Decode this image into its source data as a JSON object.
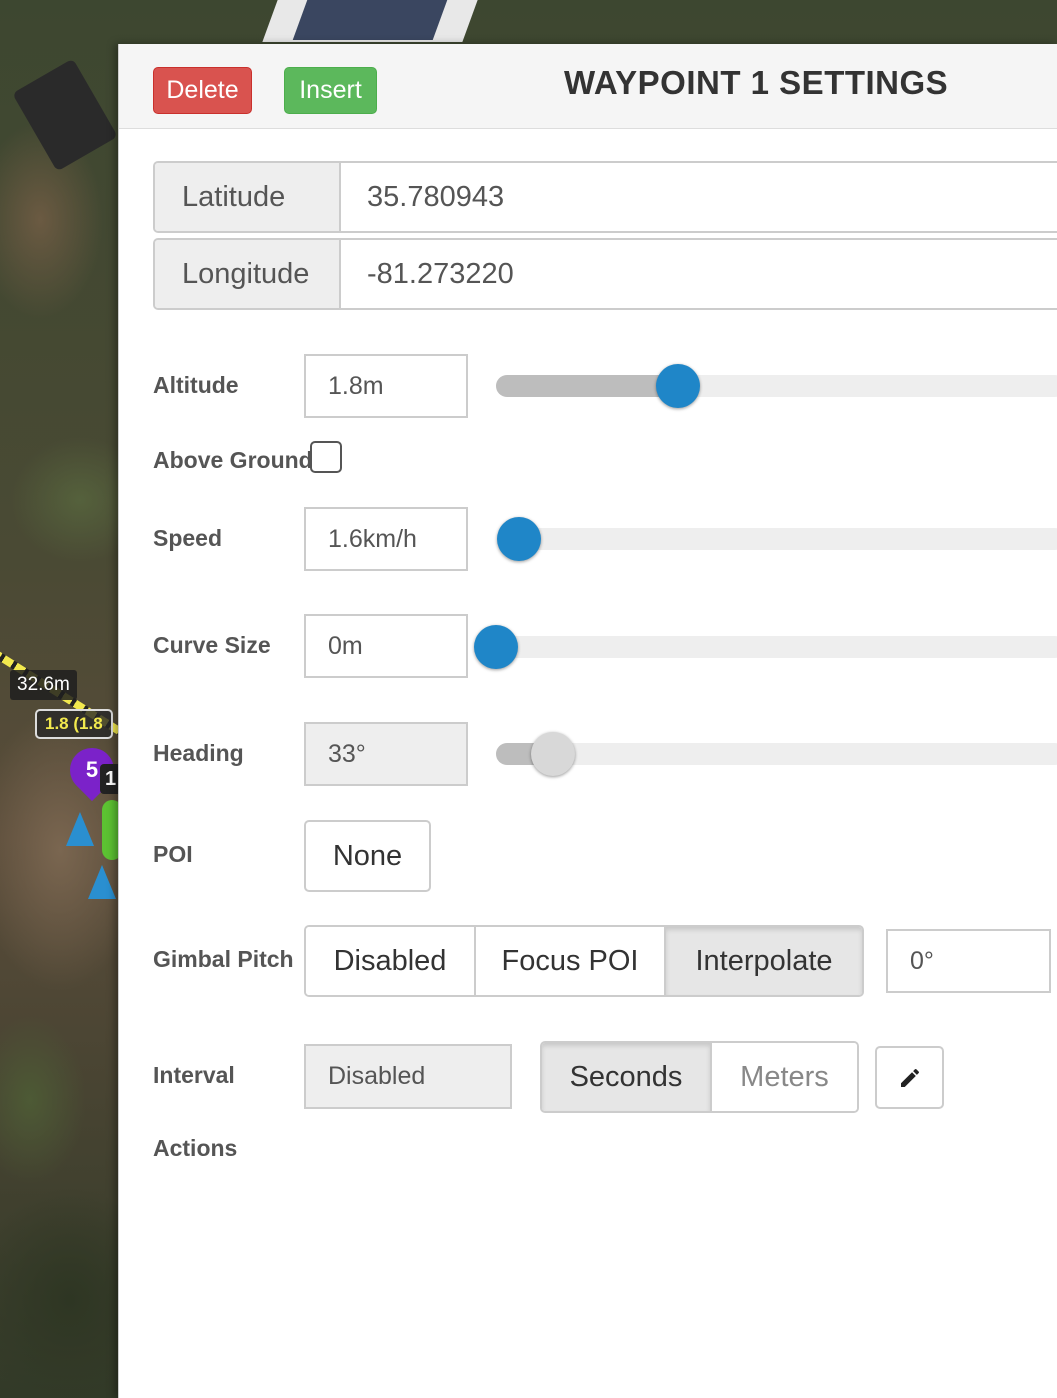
{
  "map": {
    "distance_label": "32.6m",
    "altitude_badge": "1.8 (1.8",
    "markers": [
      {
        "label": "5",
        "color": "#7b22c9"
      },
      {
        "label": "1",
        "color": "#ffffff"
      }
    ]
  },
  "header": {
    "delete_label": "Delete",
    "insert_label": "Insert",
    "title": "WAYPOINT 1 SETTINGS"
  },
  "coordinates": {
    "latitude_label": "Latitude",
    "latitude_value": "35.780943",
    "longitude_label": "Longitude",
    "longitude_value": "-81.273220"
  },
  "altitude": {
    "label": "Altitude",
    "value": "1.8m",
    "slider_fraction": 0.32
  },
  "above_ground": {
    "label": "Above Ground",
    "checked": false
  },
  "speed": {
    "label": "Speed",
    "value": "1.6km/h",
    "slider_fraction": 0.03
  },
  "curve_size": {
    "label": "Curve Size",
    "value": "0m",
    "slider_fraction": 0.0
  },
  "heading": {
    "label": "Heading",
    "value": "33°",
    "slider_fraction": 0.1
  },
  "poi": {
    "label": "POI",
    "value": "None"
  },
  "gimbal_pitch": {
    "label": "Gimbal Pitch",
    "options": [
      "Disabled",
      "Focus POI",
      "Interpolate"
    ],
    "selected": "Interpolate",
    "angle": "0°"
  },
  "interval": {
    "label": "Interval",
    "value": "Disabled",
    "units": [
      "Seconds",
      "Meters"
    ],
    "selected": "Seconds"
  },
  "actions": {
    "label": "Actions"
  },
  "colors": {
    "delete": "#d9534f",
    "insert": "#5cb85c",
    "slider_knob": "#1f86c8"
  },
  "icons": [
    "pencil-icon"
  ]
}
